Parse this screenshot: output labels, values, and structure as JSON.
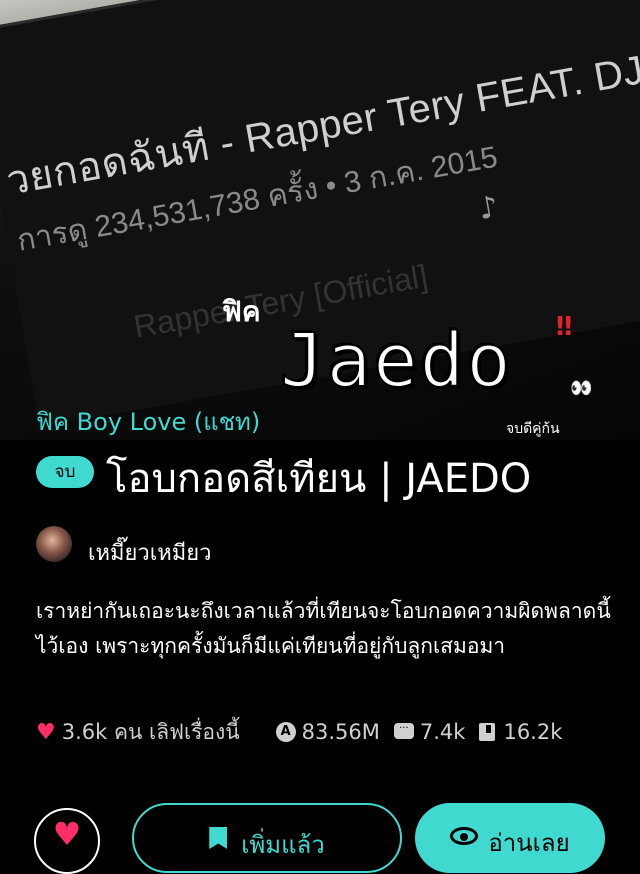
{
  "cover": {
    "song_title": "วยกอดฉันที - Rapper Tery FEAT. DJ Mi",
    "song_meta": "การดู 234,531,738 ครั้ง • 3 ก.ค. 2015",
    "channel": "Rapper Tery [Official]",
    "fic_small": "ฟิค",
    "title_art": "Jaedo",
    "title_art_sub": "จบดีคู่ก้น",
    "bang": "‼",
    "eyes": "👀"
  },
  "story": {
    "category": "ฟิค Boy Love (แชท)",
    "status": "จบ",
    "title": "โอบกอดสีเทียน | JAEDO",
    "author": "เหมี๊ยวเหมียว",
    "description": "เราหย่ากันเถอะนะถึงเวลาแล้วที่เทียนจะโอบกอดความผิดพลาดนี้ไว้เอง เพราะทุกครั้งมันก็มีแค่เทียนที่อยู่กับลูกเสมอมา"
  },
  "stats": {
    "likes": "3.6k คน เลิฟเรื่องนี้",
    "views": "83.56M",
    "comments": "7.4k",
    "bookmarks": "16.2k"
  },
  "actions": {
    "library_label": "เพิ่มแล้ว",
    "read_label": "อ่านเลย"
  },
  "colors": {
    "accent": "#40d9d0",
    "heart": "#ff2d66",
    "background": "#000000"
  }
}
